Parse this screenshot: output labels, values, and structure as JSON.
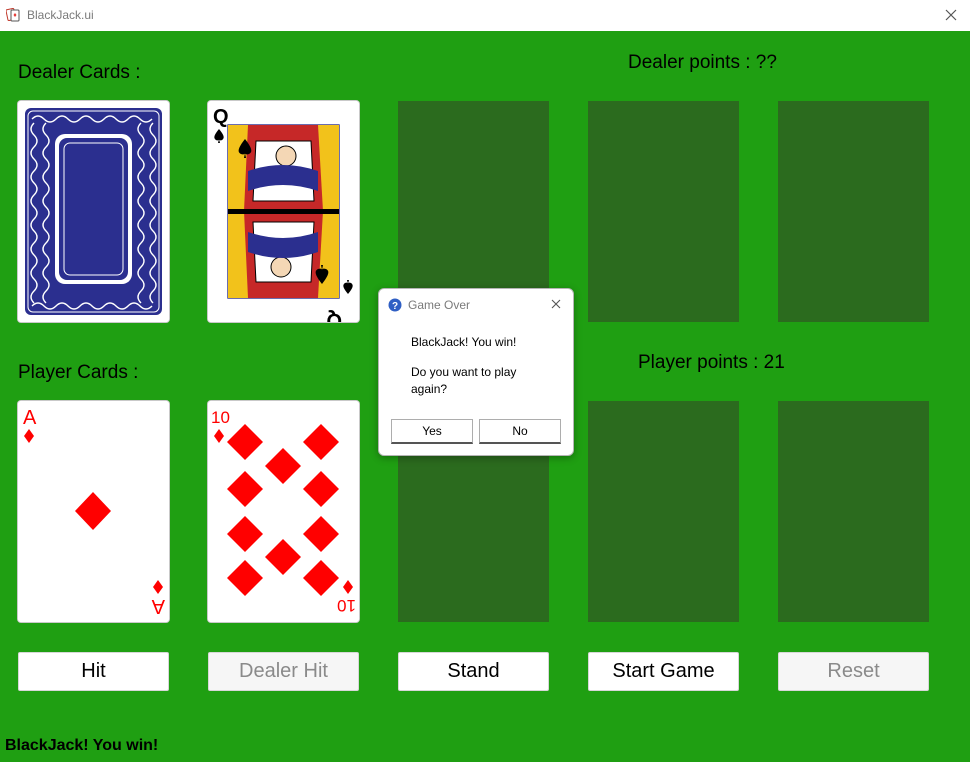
{
  "window": {
    "title": "BlackJack.ui"
  },
  "labels": {
    "dealer_cards": "Dealer Cards :",
    "dealer_points": "Dealer points : ??",
    "player_cards": "Player Cards :",
    "player_points": "Player points : 21"
  },
  "dealer_cards": [
    {
      "state": "face-down"
    },
    {
      "rank": "Q",
      "suit": "spades",
      "color": "#000000"
    },
    {
      "state": "empty"
    },
    {
      "state": "empty"
    },
    {
      "state": "empty"
    }
  ],
  "player_cards": [
    {
      "rank": "A",
      "suit": "diamonds",
      "color": "#ff0000"
    },
    {
      "rank": "10",
      "suit": "diamonds",
      "color": "#ff0000"
    },
    {
      "state": "empty"
    },
    {
      "state": "empty"
    },
    {
      "state": "empty"
    }
  ],
  "buttons": {
    "hit": "Hit",
    "dealer_hit": "Dealer Hit",
    "stand": "Stand",
    "start_game": "Start Game",
    "reset": "Reset"
  },
  "status": "BlackJack! You win!",
  "dialog": {
    "title": "Game Over",
    "message": "BlackJack! You win!",
    "question_line1": "Do you want to play",
    "question_line2": "again?",
    "yes": "Yes",
    "no": "No"
  },
  "colors": {
    "table_green": "#1f9f12",
    "empty_slot": "#2b6b1e",
    "card_back": "#2b2f8f",
    "red_suit": "#ff0000"
  },
  "icons": [
    "app-icon",
    "close-icon",
    "question-icon"
  ]
}
